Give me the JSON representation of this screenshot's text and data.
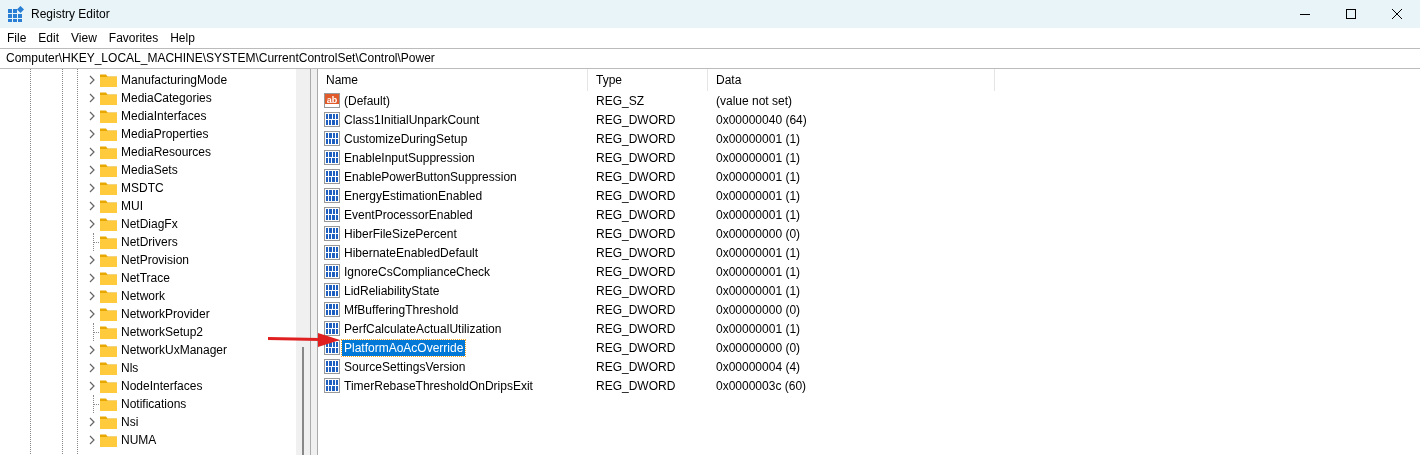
{
  "window": {
    "title": "Registry Editor"
  },
  "menu": [
    "File",
    "Edit",
    "View",
    "Favorites",
    "Help"
  ],
  "address": "Computer\\HKEY_LOCAL_MACHINE\\SYSTEM\\CurrentControlSet\\Control\\Power",
  "tree": {
    "items": [
      {
        "label": "ManufacturingMode",
        "has_children": true
      },
      {
        "label": "MediaCategories",
        "has_children": true
      },
      {
        "label": "MediaInterfaces",
        "has_children": true
      },
      {
        "label": "MediaProperties",
        "has_children": true
      },
      {
        "label": "MediaResources",
        "has_children": true
      },
      {
        "label": "MediaSets",
        "has_children": true
      },
      {
        "label": "MSDTC",
        "has_children": true
      },
      {
        "label": "MUI",
        "has_children": true
      },
      {
        "label": "NetDiagFx",
        "has_children": true
      },
      {
        "label": "NetDrivers",
        "has_children": false
      },
      {
        "label": "NetProvision",
        "has_children": true
      },
      {
        "label": "NetTrace",
        "has_children": true
      },
      {
        "label": "Network",
        "has_children": true
      },
      {
        "label": "NetworkProvider",
        "has_children": true
      },
      {
        "label": "NetworkSetup2",
        "has_children": false
      },
      {
        "label": "NetworkUxManager",
        "has_children": true
      },
      {
        "label": "Nls",
        "has_children": true
      },
      {
        "label": "NodeInterfaces",
        "has_children": true
      },
      {
        "label": "Notifications",
        "has_children": false
      },
      {
        "label": "Nsi",
        "has_children": true
      },
      {
        "label": "NUMA",
        "has_children": true
      }
    ]
  },
  "table": {
    "columns": [
      "Name",
      "Type",
      "Data"
    ],
    "rows": [
      {
        "kind": "string",
        "icon_text": "ab",
        "name": "(Default)",
        "type": "REG_SZ",
        "data": "(value not set)",
        "selected": false
      },
      {
        "kind": "binary",
        "name": "Class1InitialUnparkCount",
        "type": "REG_DWORD",
        "data": "0x00000040 (64)",
        "selected": false
      },
      {
        "kind": "binary",
        "name": "CustomizeDuringSetup",
        "type": "REG_DWORD",
        "data": "0x00000001 (1)",
        "selected": false
      },
      {
        "kind": "binary",
        "name": "EnableInputSuppression",
        "type": "REG_DWORD",
        "data": "0x00000001 (1)",
        "selected": false
      },
      {
        "kind": "binary",
        "name": "EnablePowerButtonSuppression",
        "type": "REG_DWORD",
        "data": "0x00000001 (1)",
        "selected": false
      },
      {
        "kind": "binary",
        "name": "EnergyEstimationEnabled",
        "type": "REG_DWORD",
        "data": "0x00000001 (1)",
        "selected": false
      },
      {
        "kind": "binary",
        "name": "EventProcessorEnabled",
        "type": "REG_DWORD",
        "data": "0x00000001 (1)",
        "selected": false
      },
      {
        "kind": "binary",
        "name": "HiberFileSizePercent",
        "type": "REG_DWORD",
        "data": "0x00000000 (0)",
        "selected": false
      },
      {
        "kind": "binary",
        "name": "HibernateEnabledDefault",
        "type": "REG_DWORD",
        "data": "0x00000001 (1)",
        "selected": false
      },
      {
        "kind": "binary",
        "name": "IgnoreCsComplianceCheck",
        "type": "REG_DWORD",
        "data": "0x00000001 (1)",
        "selected": false
      },
      {
        "kind": "binary",
        "name": "LidReliabilityState",
        "type": "REG_DWORD",
        "data": "0x00000001 (1)",
        "selected": false
      },
      {
        "kind": "binary",
        "name": "MfBufferingThreshold",
        "type": "REG_DWORD",
        "data": "0x00000000 (0)",
        "selected": false
      },
      {
        "kind": "binary",
        "name": "PerfCalculateActualUtilization",
        "type": "REG_DWORD",
        "data": "0x00000001 (1)",
        "selected": false
      },
      {
        "kind": "binary",
        "name": "PlatformAoAcOverride",
        "type": "REG_DWORD",
        "data": "0x00000000 (0)",
        "selected": true
      },
      {
        "kind": "binary",
        "name": "SourceSettingsVersion",
        "type": "REG_DWORD",
        "data": "0x00000004 (4)",
        "selected": false
      },
      {
        "kind": "binary",
        "name": "TimerRebaseThresholdOnDripsExit",
        "type": "REG_DWORD",
        "data": "0x0000003c (60)",
        "selected": false
      }
    ]
  }
}
